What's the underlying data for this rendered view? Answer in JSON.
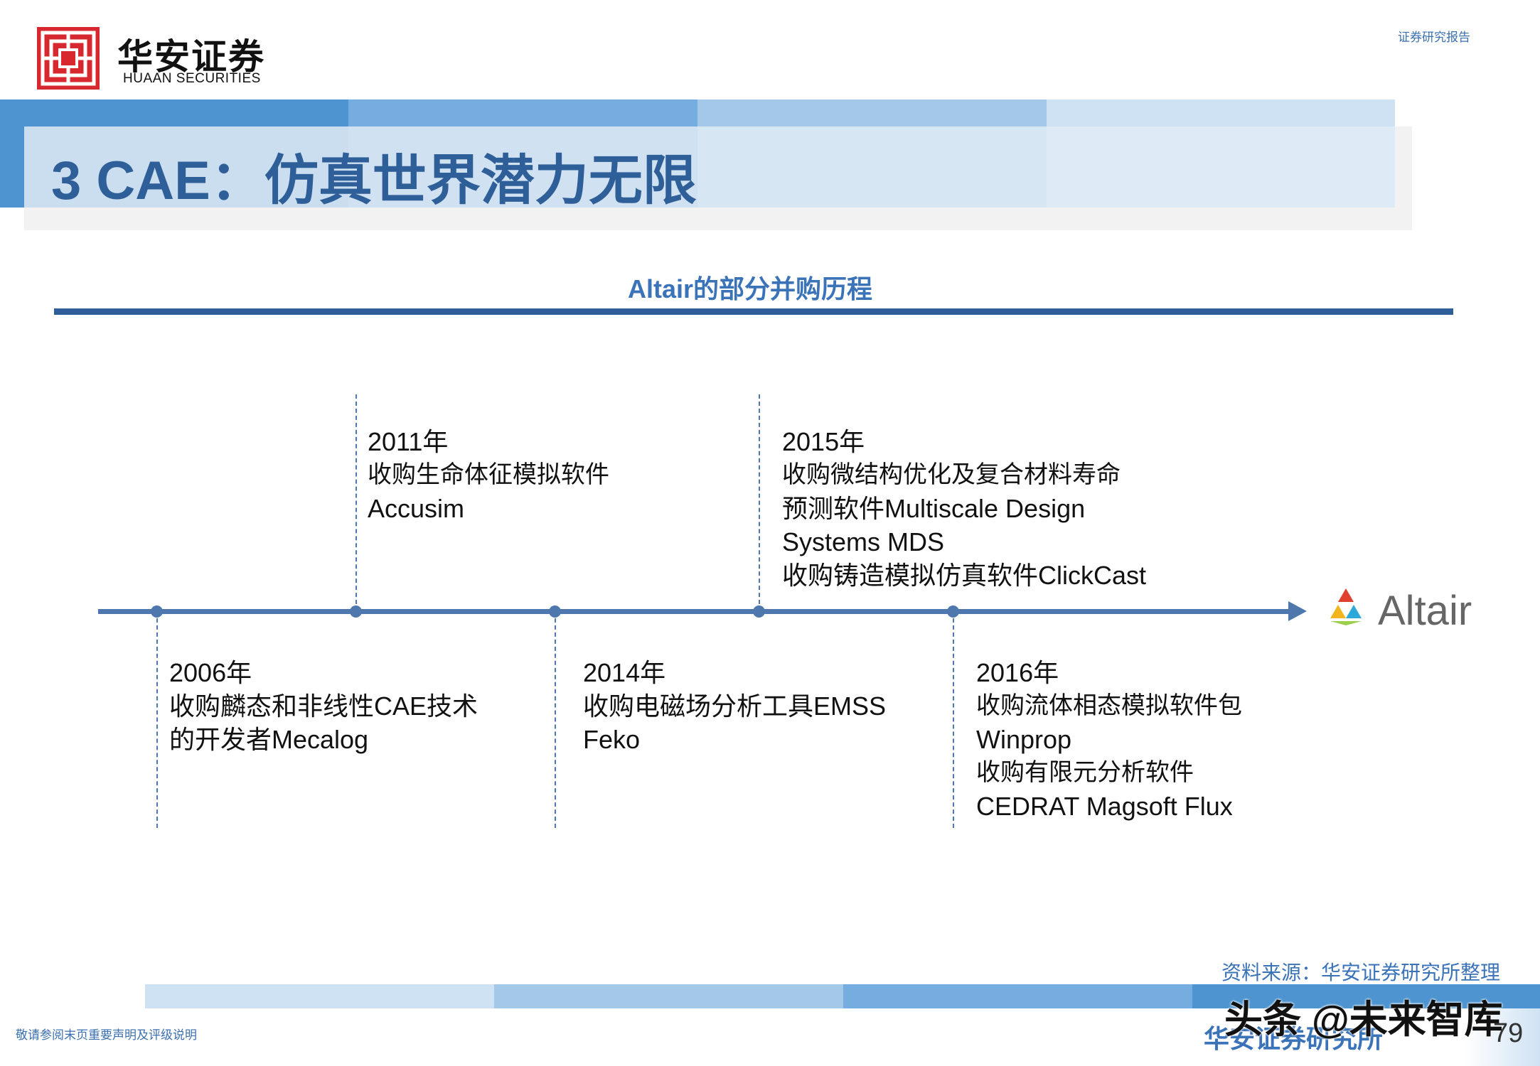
{
  "header": {
    "logo_cn": "华安证券",
    "logo_en": "HUAAN SECURITIES",
    "report_type": "证券研究报告"
  },
  "title": "3 CAE：仿真世界潜力无限",
  "chart_title": "Altair的部分并购历程",
  "colors": {
    "primary": "#2f5f98",
    "accent": "#3a73b8",
    "axis": "#4d77ad",
    "logo_red": "#d6282e"
  },
  "timeline": {
    "end_logo": {
      "icon": "altair-triangle-icon",
      "label": "Altair"
    },
    "events_above": [
      {
        "year": "2011年",
        "lines": [
          "收购生命体征模拟软件",
          "Accusim"
        ]
      },
      {
        "year": "2015年",
        "lines": [
          "收购微结构优化及复合材料寿命",
          "预测软件Multiscale Design",
          "Systems MDS",
          "收购铸造模拟仿真软件ClickCast"
        ]
      }
    ],
    "events_below": [
      {
        "year": "2006年",
        "lines": [
          "收购麟态和非线性CAE技术",
          "的开发者Mecalog"
        ]
      },
      {
        "year": "2014年",
        "lines": [
          "收购电磁场分析工具EMSS",
          "Feko"
        ]
      },
      {
        "year": "2016年",
        "lines": [
          "收购流体相态模拟软件包",
          "Winprop",
          "收购有限元分析软件",
          "CEDRAT Magsoft Flux"
        ]
      }
    ]
  },
  "footer": {
    "source": "资料来源：华安证券研究所整理",
    "disclaimer": "敬请参阅末页重要声明及评级说明",
    "org": "华安证券研究所",
    "watermark": "头条 @未来智库",
    "page": "79"
  }
}
